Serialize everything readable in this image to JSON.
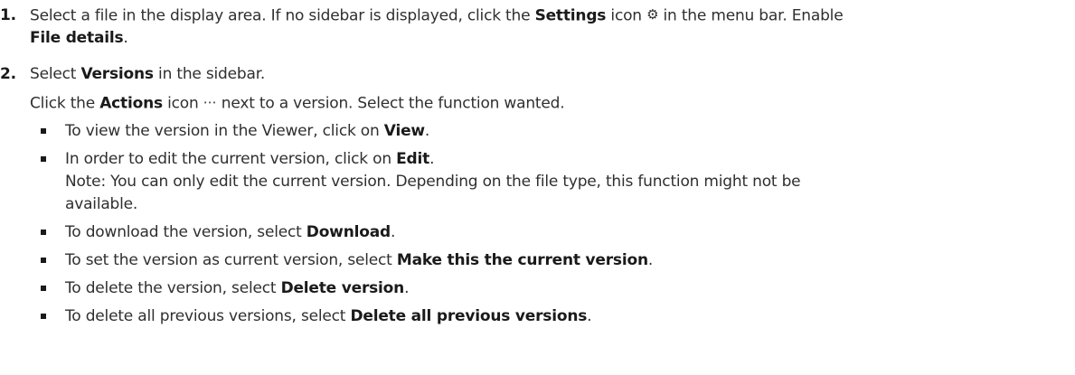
{
  "step1": {
    "number": "1.",
    "line1_a": "Select a file in the display area. If no sidebar is displayed, click the ",
    "line1_bold": "Settings",
    "line1_b": " icon ",
    "line1_icon": "gear-icon",
    "line1_c": " in the menu bar. Enable",
    "line2_bold": "File details",
    "line2_end": "."
  },
  "step2": {
    "number": "2.",
    "line1_a": "Select ",
    "line1_bold": "Versions",
    "line1_b": " in the sidebar.",
    "line2_a": "Click the ",
    "line2_bold": "Actions",
    "line2_b": " icon ",
    "line2_icon": "more-horizontal-icon",
    "line2_c": " next to a version. Select the function wanted.",
    "bullets": [
      {
        "a": "To view the version in the Viewer, click on ",
        "bold": "View",
        "b": "."
      },
      {
        "a": "In order to edit the current version, click on ",
        "bold": "Edit",
        "b": "."
      },
      {
        "a": "To download the version, select ",
        "bold": "Download",
        "b": "."
      },
      {
        "a": "To set the version as current version, select ",
        "bold": "Make this the current version",
        "b": "."
      },
      {
        "a": "To delete the version, select ",
        "bold": "Delete version",
        "b": "."
      },
      {
        "a": "To delete all previous versions, select ",
        "bold": "Delete all previous versions",
        "b": "."
      }
    ],
    "note_line1": "Note: You can only edit the current version. Depending on the file type, this function might not be",
    "note_line2": "available."
  }
}
